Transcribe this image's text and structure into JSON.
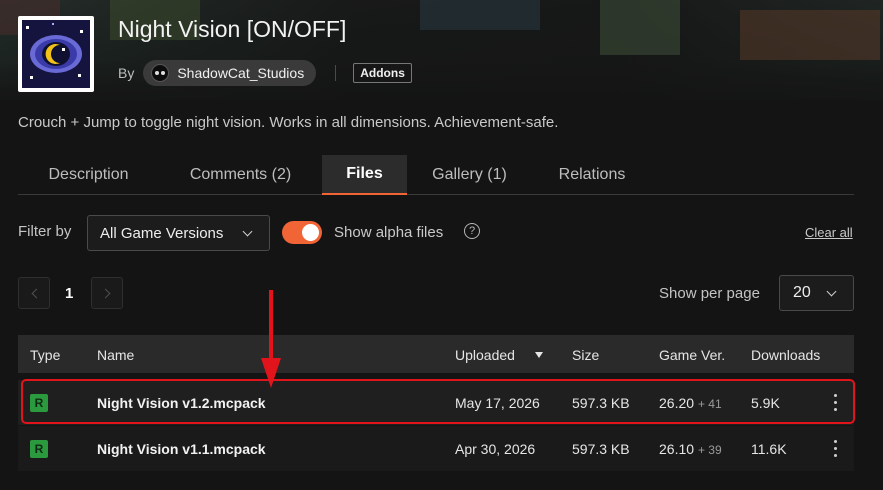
{
  "project": {
    "title": "Night Vision [ON/OFF]",
    "by_label": "By",
    "author": "ShadowCat_Studios",
    "category_tag": "Addons",
    "summary": "Crouch + Jump to toggle night vision. Works in all dimensions. Achievement-safe."
  },
  "tabs": [
    {
      "label": "Description",
      "active": false
    },
    {
      "label": "Comments (2)",
      "active": false
    },
    {
      "label": "Files",
      "active": true
    },
    {
      "label": "Gallery (1)",
      "active": false
    },
    {
      "label": "Relations",
      "active": false
    }
  ],
  "filters": {
    "filter_by_label": "Filter by",
    "game_version_value": "All Game Versions",
    "alpha_toggle_on": true,
    "alpha_label": "Show alpha files",
    "help_glyph": "?",
    "clear_all": "Clear all"
  },
  "pagination": {
    "current_page": "1",
    "per_page_label": "Show per page",
    "per_page_value": "20"
  },
  "table": {
    "headers": {
      "type": "Type",
      "name": "Name",
      "uploaded": "Uploaded",
      "size": "Size",
      "game_ver": "Game Ver.",
      "downloads": "Downloads"
    },
    "sorted_by": "uploaded",
    "rows": [
      {
        "type": "R",
        "name": "Night Vision v1.2.mcpack",
        "uploaded": "May 17, 2026",
        "size": "597.3 KB",
        "game_ver": "26.20",
        "game_ver_extra": "+ 41",
        "downloads": "5.9K"
      },
      {
        "type": "R",
        "name": "Night Vision v1.1.mcpack",
        "uploaded": "Apr 30, 2026",
        "size": "597.3 KB",
        "game_ver": "26.10",
        "game_ver_extra": "+ 39",
        "downloads": "11.6K"
      }
    ]
  },
  "colors": {
    "accent": "#f16436",
    "release_badge": "#2b9a3e",
    "annotation_red": "#e1131b"
  },
  "icons": {
    "select_chevron": "chevron-down-icon",
    "prev": "chevron-left-icon",
    "next": "chevron-right-icon",
    "sort": "sort-desc-icon",
    "row_menu": "kebab-menu-icon",
    "help": "question-circle-icon"
  }
}
